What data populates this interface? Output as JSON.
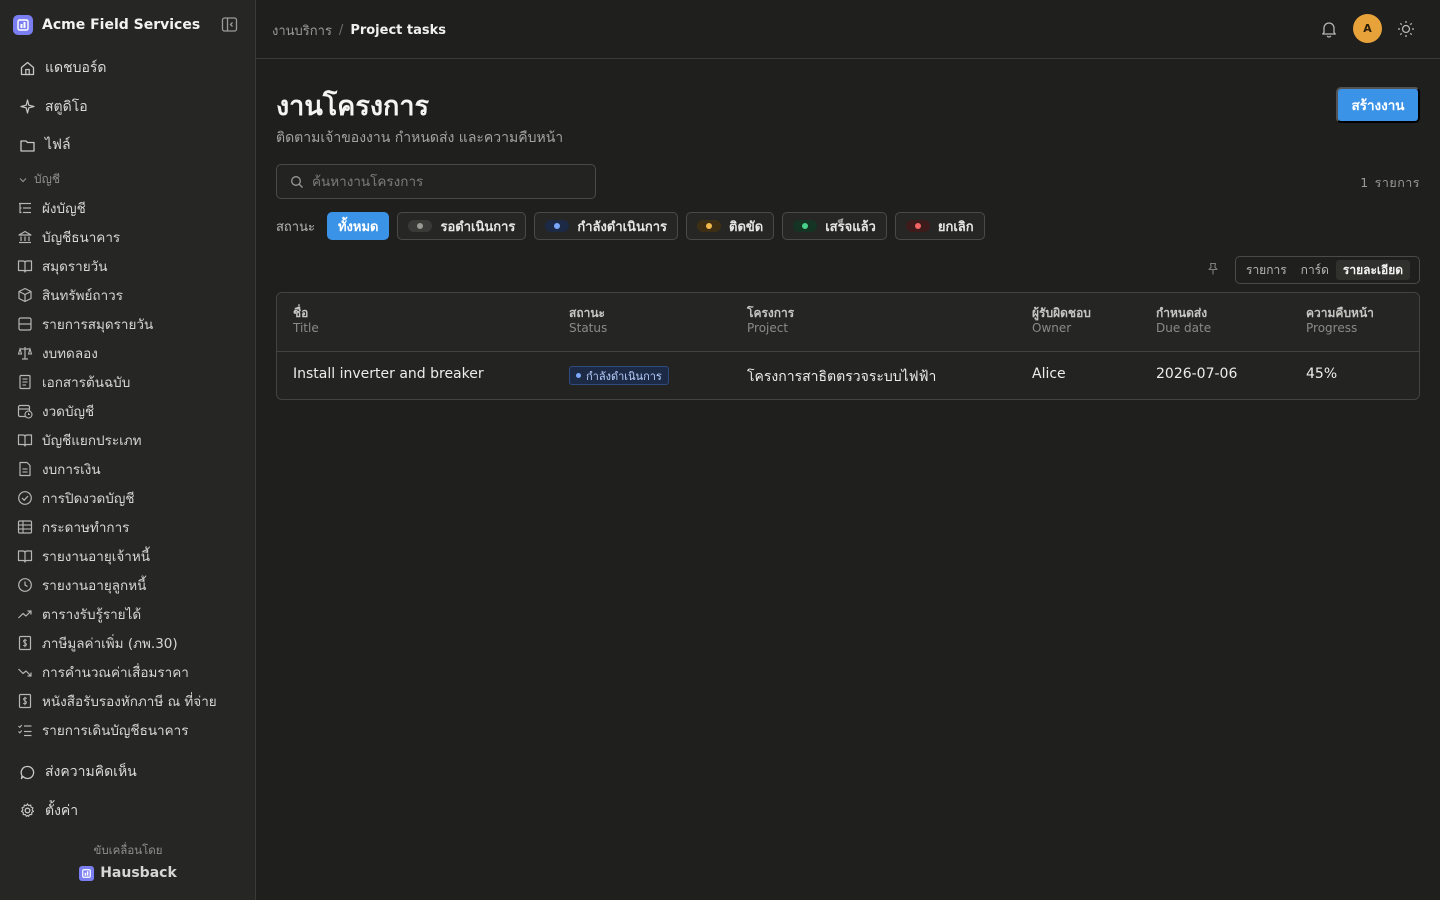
{
  "app": {
    "name": "Acme Field Services"
  },
  "sidebar": {
    "top_items": [
      {
        "label": "แดชบอร์ด",
        "icon": "home-icon"
      },
      {
        "label": "สตูดิโอ",
        "icon": "sparkle-icon"
      },
      {
        "label": "ไฟล์",
        "icon": "folder-icon"
      }
    ],
    "group_label": "บัญชี",
    "sub_items": [
      {
        "label": "ผังบัญชี",
        "icon": "list-tree-icon"
      },
      {
        "label": "บัญชีธนาคาร",
        "icon": "bank-icon"
      },
      {
        "label": "สมุดรายวัน",
        "icon": "book-open-icon"
      },
      {
        "label": "สินทรัพย์ถาวร",
        "icon": "package-icon"
      },
      {
        "label": "รายการสมุดรายวัน",
        "icon": "journal-lines-icon"
      },
      {
        "label": "งบทดลอง",
        "icon": "scale-icon"
      },
      {
        "label": "เอกสารต้นฉบับ",
        "icon": "document-icon"
      },
      {
        "label": "งวดบัญชี",
        "icon": "calendar-clock-icon"
      },
      {
        "label": "บัญชีแยกประเภท",
        "icon": "book-open-icon"
      },
      {
        "label": "งบการเงิน",
        "icon": "file-text-icon"
      },
      {
        "label": "การปิดงวดบัญชี",
        "icon": "check-circle-icon"
      },
      {
        "label": "กระดาษทำการ",
        "icon": "table-grid-icon"
      },
      {
        "label": "รายงานอายุเจ้าหนี้",
        "icon": "book-open-icon"
      },
      {
        "label": "รายงานอายุลูกหนี้",
        "icon": "clock-icon"
      },
      {
        "label": "ตารางรับรู้รายได้",
        "icon": "trending-up-icon"
      },
      {
        "label": "ภาษีมูลค่าเพิ่ม (ภพ.30)",
        "icon": "receipt-dollar-icon"
      },
      {
        "label": "การคำนวณค่าเสื่อมราคา",
        "icon": "trending-down-icon"
      },
      {
        "label": "หนังสือรับรองหักภาษี ณ ที่จ่าย",
        "icon": "receipt-dollar-icon"
      },
      {
        "label": "รายการเดินบัญชีธนาคาร",
        "icon": "list-checks-icon"
      }
    ],
    "bottom_items": [
      {
        "label": "ส่งความคิดเห็น",
        "icon": "message-circle-icon"
      },
      {
        "label": "ตั้งค่า",
        "icon": "gear-icon"
      }
    ],
    "powered_by": "ขับเคลื่อนโดย",
    "powered_brand": "Hausback"
  },
  "header": {
    "breadcrumb_parent": "งานบริการ",
    "breadcrumb_sep": "/",
    "breadcrumb_current": "Project tasks",
    "avatar_initial": "A"
  },
  "main": {
    "title": "งานโครงการ",
    "subtitle": "ติดตามเจ้าของงาน กำหนดส่ง และความคืบหน้า",
    "create_button": "สร้างงาน",
    "search_placeholder": "ค้นหางานโครงการ",
    "count_number": "1",
    "count_unit": "รายการ",
    "status_label": "สถานะ",
    "filters": [
      {
        "label": "ทั้งหมด",
        "active": true
      },
      {
        "label": "รอดำเนินการ",
        "dot": "#9a9a96",
        "pill": "#3a3a37"
      },
      {
        "label": "กำลังดำเนินการ",
        "dot": "#7aa8ff",
        "pill": "#1d2a45"
      },
      {
        "label": "ติดขัด",
        "dot": "#f2b84b",
        "pill": "#3e2f14"
      },
      {
        "label": "เสร็จแล้ว",
        "dot": "#48d18a",
        "pill": "#153424"
      },
      {
        "label": "ยกเลิก",
        "dot": "#f06464",
        "pill": "#3d1b1b"
      }
    ],
    "views": [
      "รายการ",
      "การ์ด",
      "รายละเอียด"
    ],
    "active_view": "รายละเอียด"
  },
  "table": {
    "columns": [
      {
        "th": "ชื่อ",
        "en": "Title"
      },
      {
        "th": "สถานะ",
        "en": "Status"
      },
      {
        "th": "โครงการ",
        "en": "Project"
      },
      {
        "th": "ผู้รับผิดชอบ",
        "en": "Owner"
      },
      {
        "th": "กำหนดส่ง",
        "en": "Due date"
      },
      {
        "th": "ความคืบหน้า",
        "en": "Progress"
      }
    ],
    "rows": [
      {
        "title": "Install inverter and breaker",
        "status": "กำลังดำเนินการ",
        "project": "โครงการสาธิตตรวจระบบไฟฟ้า",
        "owner": "Alice",
        "due": "2026-07-06",
        "progress": "45%"
      }
    ]
  },
  "colors": {
    "accent": "#3b93e8",
    "brand": "#7b7ef0",
    "avatar": "#e8a23a"
  }
}
